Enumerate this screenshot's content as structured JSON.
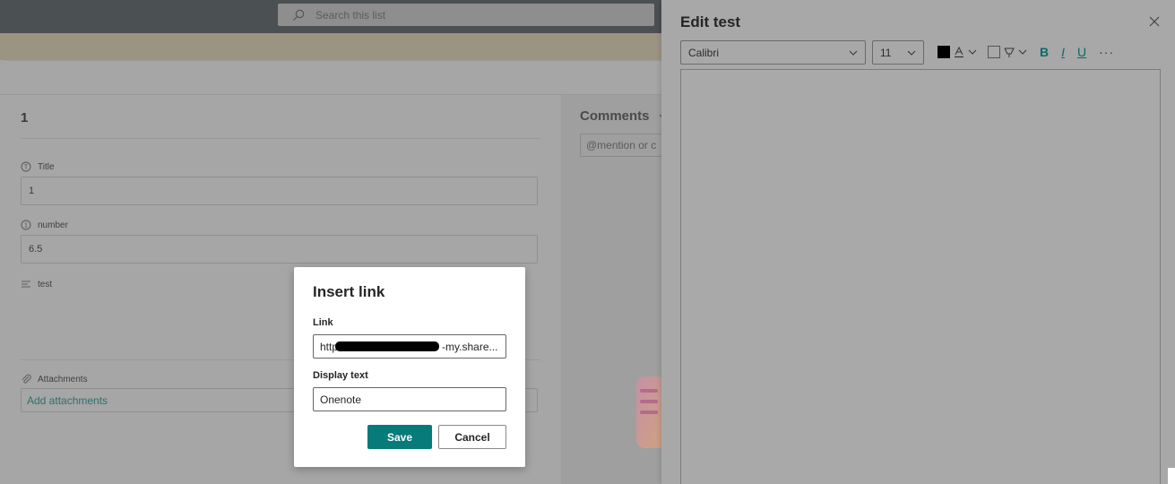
{
  "topbar": {
    "search_placeholder": "Search this list"
  },
  "item_form": {
    "item_id": "1",
    "fields": [
      {
        "label": "Title",
        "value": "1",
        "icon": "text-field-icon"
      },
      {
        "label": "number",
        "value": "6.5",
        "icon": "number-field-icon"
      },
      {
        "label": "test",
        "value": "",
        "icon": "multiline-field-icon"
      }
    ],
    "attachments": {
      "label": "Attachments",
      "link": "Add attachments",
      "icon": "paperclip-icon"
    }
  },
  "comments": {
    "title": "Comments",
    "input_placeholder": "@mention or c"
  },
  "edit_panel": {
    "title": "Edit test",
    "toolbar": {
      "font": "Calibri",
      "size": "11",
      "bold": "B",
      "italic": "I",
      "underline": "U",
      "more": "···"
    }
  },
  "insert_link_dialog": {
    "title": "Insert link",
    "link_label": "Link",
    "link_value": "https://                              -my.share...",
    "display_text_label": "Display text",
    "display_text_value": "Onenote",
    "save_label": "Save",
    "cancel_label": "Cancel"
  },
  "colors": {
    "accent": "#077a7a",
    "overlay": "#a6a6a6"
  }
}
